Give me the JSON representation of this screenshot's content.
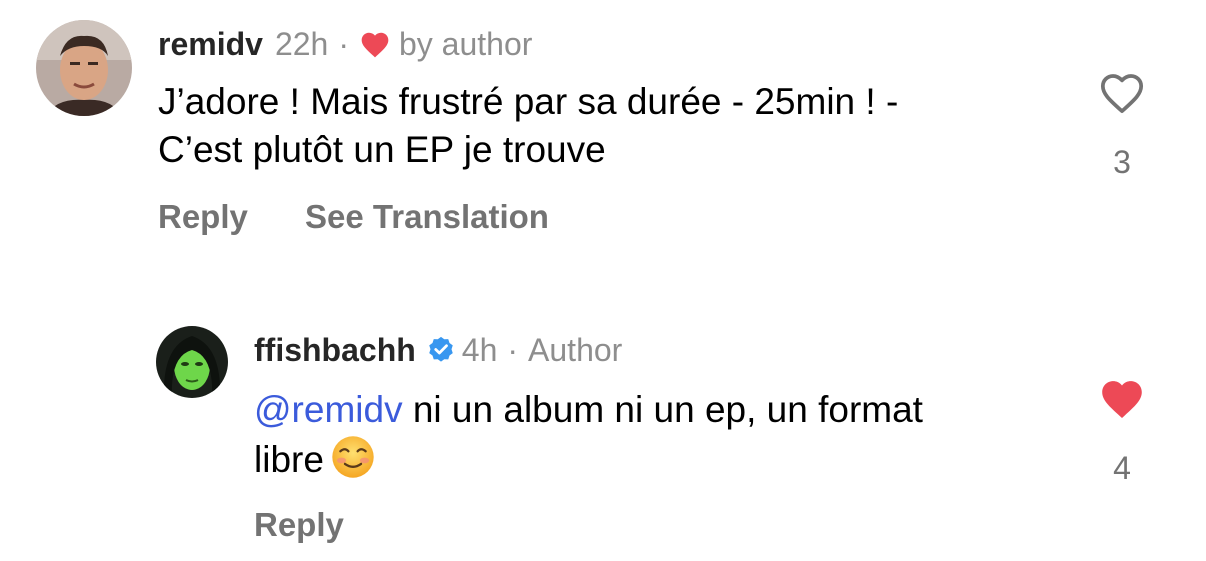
{
  "comments": [
    {
      "username": "remidv",
      "time": "22h",
      "separator": "·",
      "liked_by_author_label": "by author",
      "text_line1": "J’adore ! Mais frustré par sa durée - 25min ! -",
      "text_line2": "C’est plutôt un EP je trouve",
      "reply_label": "Reply",
      "translate_label": "See Translation",
      "like_count": "3",
      "liked": false
    },
    {
      "username": "ffishbachh",
      "verified": true,
      "time": "4h",
      "separator": "·",
      "author_label": "Author",
      "mention": "@remidv",
      "text_line1": " ni un album ni un ep, un format",
      "text_line2": "libre",
      "emoji": "smiling-face-with-smiling-eyes",
      "reply_label": "Reply",
      "like_count": "4",
      "liked": true
    }
  ],
  "colors": {
    "heart_red": "#ed4956",
    "verified_blue": "#3897f0",
    "mention_blue": "#3b5bdb",
    "muted_gray": "#737373"
  }
}
